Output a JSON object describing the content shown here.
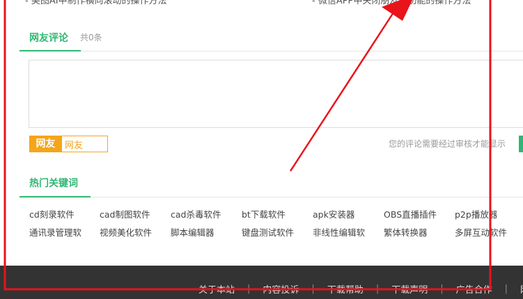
{
  "related_links": [
    "- 美图AI中制作横向滚动的操作方法",
    "- 微信APP中关闭朋友圈功能的操作方法"
  ],
  "comments": {
    "title": "网友评论",
    "count": "共0条",
    "textarea_placeholder": "",
    "nick_label": "网友",
    "nick_value": "网友",
    "notice": "您的评论需要经过审核才能显示"
  },
  "hot_keywords": {
    "title": "热门关键词",
    "row1": [
      "cd刻录软件",
      "cad制图软件",
      "cad杀毒软件",
      "bt下载软件",
      "apk安装器",
      "OBS直播插件",
      "p2p播放器"
    ],
    "row2": [
      "通讯录管理软",
      "视频美化软件",
      "脚本编辑器",
      "键盘测试软件",
      "非线性编辑软",
      "繁体转换器",
      "多屏互动软件"
    ]
  },
  "footer": {
    "links": [
      "关于本站",
      "内容投诉",
      "下载帮助",
      "下载声明",
      "广告合作",
      "网"
    ]
  },
  "colors": {
    "accent_green": "#2fb872",
    "nick_orange": "#f5a51a",
    "annotation_red": "#e8131b",
    "footer_bg": "#333333"
  }
}
